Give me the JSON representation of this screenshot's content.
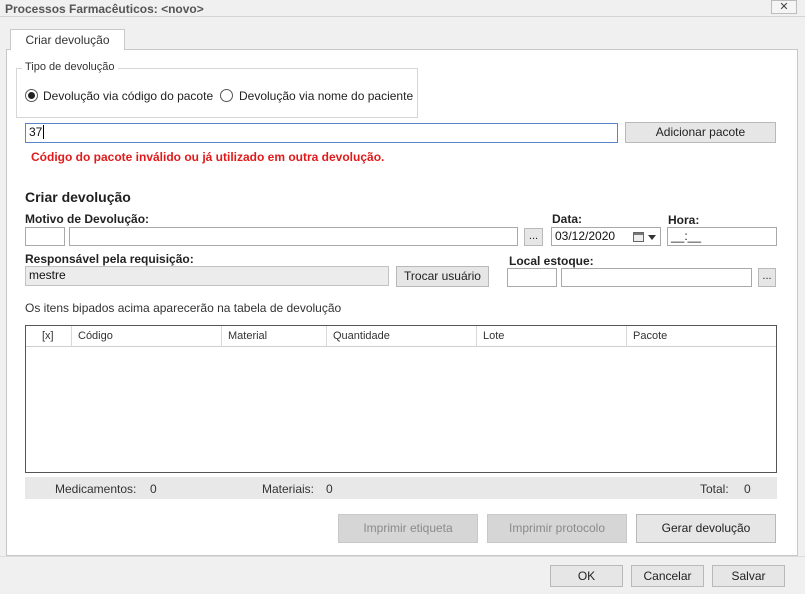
{
  "window": {
    "title": "Processos Farmacêuticos: <novo>",
    "close_glyph": "✕"
  },
  "tabs": [
    {
      "label": "Criar devolução",
      "active": true
    }
  ],
  "tipo_devolucao": {
    "title": "Tipo de devolução",
    "options": [
      {
        "label": "Devolução via código do pacote",
        "checked": true
      },
      {
        "label": "Devolução via nome do paciente",
        "checked": false
      }
    ]
  },
  "pacote": {
    "value": "37",
    "add_button": "Adicionar pacote",
    "error": "Código do pacote inválido ou já utilizado em outra devolução."
  },
  "form": {
    "section_title": "Criar devolução",
    "motivo_label": "Motivo de Devolução:",
    "motivo_code": "",
    "motivo_desc": "",
    "lookup_glyph": "...",
    "data_label": "Data:",
    "data_value": "03/12/2020",
    "hora_label": "Hora:",
    "hora_value": "__:__",
    "responsavel_label": "Responsável pela requisição:",
    "responsavel_value": "mestre",
    "trocar_button": "Trocar usuário",
    "local_label": "Local estoque:",
    "local_code": "",
    "local_desc": "",
    "hint": "Os itens bipados acima aparecerão na tabela de devolução"
  },
  "table": {
    "columns": [
      "[x]",
      "Código",
      "Material",
      "Quantidade",
      "Lote",
      "Pacote"
    ],
    "rows": []
  },
  "summary": {
    "medicamentos_label": "Medicamentos:",
    "medicamentos_value": "0",
    "materiais_label": "Materiais:",
    "materiais_value": "0",
    "total_label": "Total:",
    "total_value": "0"
  },
  "actions": {
    "imprimir_etiqueta": "Imprimir etiqueta",
    "imprimir_protocolo": "Imprimir protocolo",
    "gerar_devolucao": "Gerar devolução"
  },
  "footer": {
    "ok": "OK",
    "cancel": "Cancelar",
    "save": "Salvar"
  }
}
